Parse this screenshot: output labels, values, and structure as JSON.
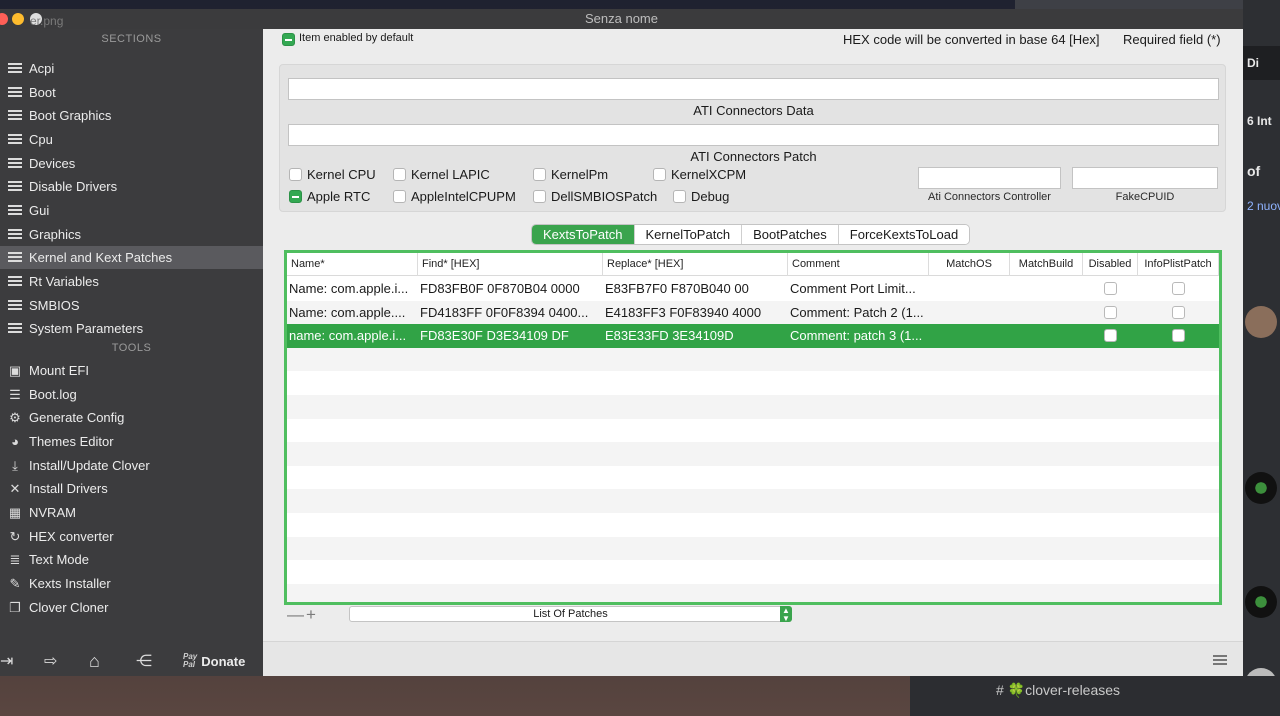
{
  "window": {
    "title": "Senza nome",
    "bg_filename": "er.png"
  },
  "sidebar": {
    "sections_header": "SECTIONS",
    "sections": [
      {
        "label": "Acpi"
      },
      {
        "label": "Boot"
      },
      {
        "label": "Boot Graphics"
      },
      {
        "label": "Cpu"
      },
      {
        "label": "Devices"
      },
      {
        "label": "Disable Drivers"
      },
      {
        "label": "Gui"
      },
      {
        "label": "Graphics"
      },
      {
        "label": "Kernel and Kext Patches",
        "selected": true
      },
      {
        "label": "Rt Variables"
      },
      {
        "label": "SMBIOS"
      },
      {
        "label": "System Parameters"
      }
    ],
    "tools_header": "TOOLS",
    "tools": [
      {
        "label": "Mount EFI",
        "icon": "disk-icon"
      },
      {
        "label": "Boot.log",
        "icon": "log-icon"
      },
      {
        "label": "Generate Config",
        "icon": "gears-icon"
      },
      {
        "label": "Themes Editor",
        "icon": "palette-icon"
      },
      {
        "label": "Install/Update Clover",
        "icon": "download-icon"
      },
      {
        "label": "Install Drivers",
        "icon": "tools-icon"
      },
      {
        "label": "NVRAM",
        "icon": "chip-icon"
      },
      {
        "label": "HEX converter",
        "icon": "refresh-icon"
      },
      {
        "label": "Text Mode",
        "icon": "text-icon"
      },
      {
        "label": "Kexts Installer",
        "icon": "brush-icon"
      },
      {
        "label": "Clover Cloner",
        "icon": "copy-icon"
      }
    ],
    "footer": {
      "paypal_1": "Pay",
      "paypal_2": "Pal",
      "donate_label": "Donate"
    }
  },
  "topbar": {
    "item_enabled": "Item enabled by default",
    "hex_note": "HEX code will be converted in base 64 [Hex]",
    "required_note": "Required field (*)"
  },
  "ati": {
    "connectors_data_label": "ATI Connectors Data",
    "connectors_data_value": "",
    "connectors_patch_label": "ATI Connectors Patch",
    "connectors_patch_value": "",
    "controller_label": "Ati Connectors Controller",
    "controller_value": "",
    "fakecpuid_label": "FakeCPUID",
    "fakecpuid_value": ""
  },
  "options": [
    {
      "label": "Kernel CPU",
      "checked": false
    },
    {
      "label": "Kernel LAPIC",
      "checked": false
    },
    {
      "label": "KernelPm",
      "checked": false
    },
    {
      "label": "KernelXCPM",
      "checked": false
    },
    {
      "label": "Apple RTC",
      "checked": true
    },
    {
      "label": "AppleIntelCPUPM",
      "checked": false
    },
    {
      "label": "DellSMBIOSPatch",
      "checked": false
    },
    {
      "label": "Debug",
      "checked": false
    }
  ],
  "tabs": [
    {
      "label": "KextsToPatch",
      "active": true
    },
    {
      "label": "KernelToPatch"
    },
    {
      "label": "BootPatches"
    },
    {
      "label": "ForceKextsToLoad"
    }
  ],
  "table": {
    "columns": [
      "Name*",
      "Find* [HEX]",
      "Replace* [HEX]",
      "Comment",
      "MatchOS",
      "MatchBuild",
      "Disabled",
      "InfoPlistPatch"
    ],
    "rows": [
      {
        "name": "Name: com.apple.i...",
        "find": "FD83FB0F 0F870B04 0000",
        "replace": "E83FB7F0 F870B040 00",
        "comment": "Comment Port Limit...",
        "matchos": "",
        "matchbuild": "",
        "disabled": false,
        "infoplist": false
      },
      {
        "name": "Name: com.apple....",
        "find": "FD4183FF 0F0F8394 0400...",
        "replace": "E4183FF3 F0F83940 4000",
        "comment": "Comment: Patch 2 (1...",
        "matchos": "",
        "matchbuild": "",
        "disabled": false,
        "infoplist": false
      },
      {
        "name": "name: com.apple.i...",
        "find": "FD83E30F D3E34109 DF",
        "replace": "E83E33FD 3E34109D",
        "comment": "Comment: patch 3 (1...",
        "matchos": "",
        "matchbuild": "",
        "disabled": false,
        "infoplist": false,
        "selected": true
      }
    ]
  },
  "bottom": {
    "minus": "—",
    "plus": "+",
    "popup_label": "List Of Patches"
  },
  "background": {
    "channel": "# 🍀clover-releases",
    "right_texts": [
      "Di",
      "6 Int",
      "of",
      "2 nuov"
    ]
  }
}
